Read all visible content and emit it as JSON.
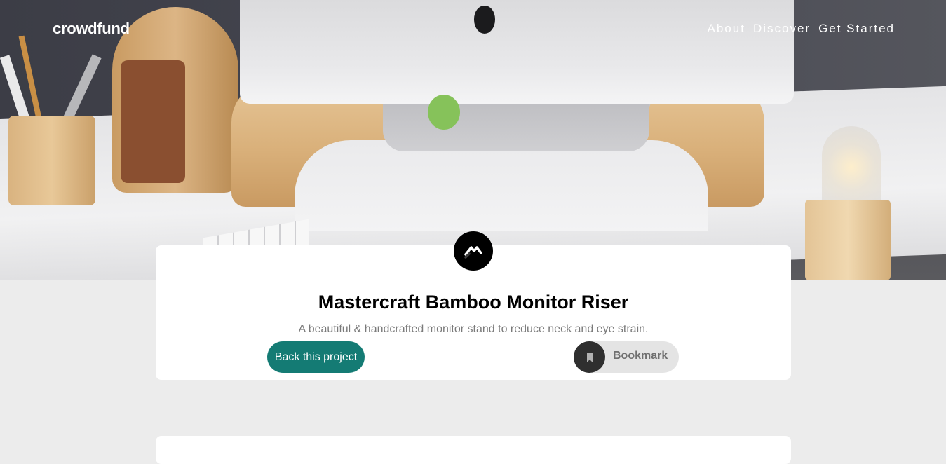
{
  "header": {
    "logo": "crowdfund",
    "nav": [
      {
        "label": "About"
      },
      {
        "label": "Discover"
      },
      {
        "label": "Get Started"
      }
    ]
  },
  "project": {
    "title": "Mastercraft Bamboo Monitor Riser",
    "description": "A beautiful & handcrafted monitor stand to reduce neck and eye strain.",
    "back_button": "Back this project",
    "bookmark_button": "Bookmark",
    "logo_icon": "mastercraft-logo-icon",
    "bookmark_icon": "bookmark-icon"
  },
  "colors": {
    "accent": "#147b74",
    "page_bg": "#ececec",
    "card_bg": "#ffffff",
    "bookmark_circle": "#2f2f2f",
    "bookmark_bg": "#e4e4e4"
  }
}
